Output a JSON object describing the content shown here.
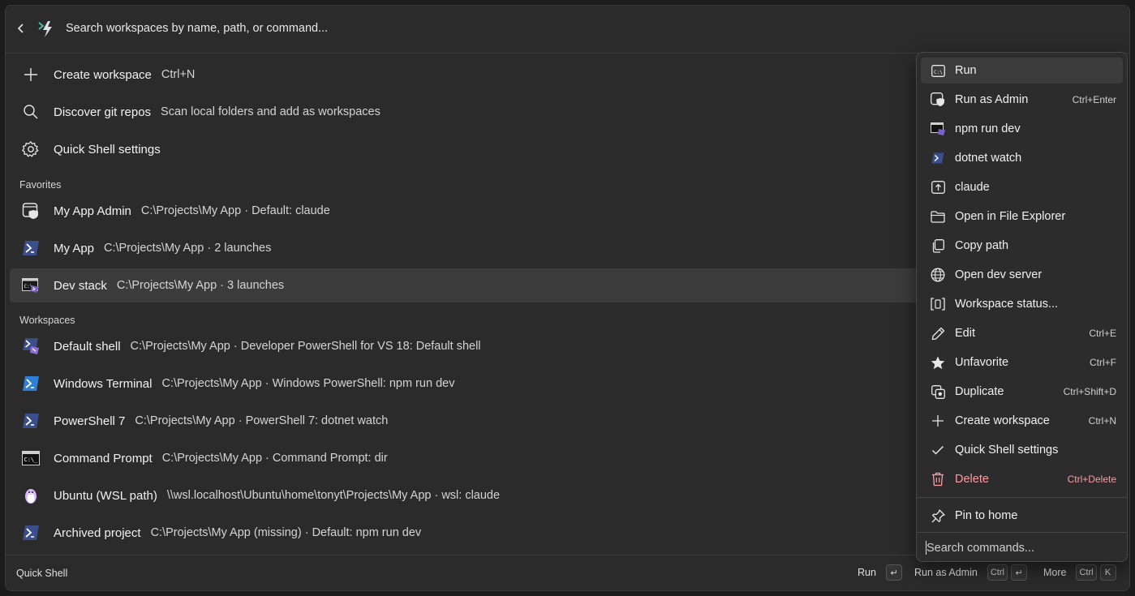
{
  "search": {
    "placeholder": "Search workspaces by name, path, or command..."
  },
  "actions": [
    {
      "icon": "plus-icon",
      "title": "Create workspace",
      "subtitle": "Ctrl+N"
    },
    {
      "icon": "search-icon",
      "title": "Discover git repos",
      "subtitle": "Scan local folders and add as workspaces"
    },
    {
      "icon": "gear-icon",
      "title": "Quick Shell settings",
      "subtitle": ""
    }
  ],
  "favorites": {
    "heading": "Favorites",
    "items": [
      {
        "icon": "shield-terminal-icon",
        "title": "My App Admin",
        "subtitle": "C:\\Projects\\My App · Default: claude"
      },
      {
        "icon": "powershell-icon",
        "title": "My App",
        "subtitle": "C:\\Projects\\My App · 2 launches"
      },
      {
        "icon": "cmd-stack-icon",
        "title": "Dev stack",
        "subtitle": "C:\\Projects\\My App · 3 launches",
        "selected": true
      }
    ]
  },
  "workspaces": {
    "heading": "Workspaces",
    "items": [
      {
        "icon": "dev-powershell-icon",
        "title": "Default shell",
        "subtitle": "C:\\Projects\\My App · Developer PowerShell for VS 18: Default shell"
      },
      {
        "icon": "windows-terminal-icon",
        "title": "Windows Terminal",
        "subtitle": "C:\\Projects\\My App · Windows PowerShell: npm run dev"
      },
      {
        "icon": "powershell-icon",
        "title": "PowerShell 7",
        "subtitle": "C:\\Projects\\My App · PowerShell 7: dotnet watch"
      },
      {
        "icon": "command-prompt-icon",
        "title": "Command Prompt",
        "subtitle": "C:\\Projects\\My App · Command Prompt: dir"
      },
      {
        "icon": "linux-penguin-icon",
        "title": "Ubuntu (WSL path)",
        "subtitle": "\\\\wsl.localhost\\Ubuntu\\home\\tonyt\\Projects\\My App · wsl: claude"
      },
      {
        "icon": "powershell-icon",
        "title": "Archived project",
        "subtitle": "C:\\Projects\\My App (missing) · Default: npm run dev"
      }
    ]
  },
  "status_bar": {
    "app_name": "Quick Shell",
    "hints": [
      {
        "label": "Run",
        "keys": [
          "↵"
        ]
      },
      {
        "label": "Run as Admin",
        "keys": [
          "Ctrl",
          "↵"
        ]
      },
      {
        "label": "More",
        "keys": [
          "Ctrl",
          "K"
        ]
      }
    ]
  },
  "context_menu": {
    "items": [
      {
        "icon": "run-terminal-icon",
        "label": "Run",
        "shortcut": "",
        "active": true
      },
      {
        "icon": "shield-icon",
        "label": "Run as Admin",
        "shortcut": "Ctrl+Enter"
      },
      {
        "icon": "cmd-stack-icon",
        "label": "npm run dev",
        "shortcut": ""
      },
      {
        "icon": "powershell-icon",
        "label": "dotnet watch",
        "shortcut": ""
      },
      {
        "icon": "upload-window-icon",
        "label": "claude",
        "shortcut": ""
      },
      {
        "icon": "folder-icon",
        "label": "Open in File Explorer",
        "shortcut": ""
      },
      {
        "icon": "copy-icon",
        "label": "Copy path",
        "shortcut": ""
      },
      {
        "icon": "globe-icon",
        "label": "Open dev server",
        "shortcut": ""
      },
      {
        "icon": "status-frame-icon",
        "label": "Workspace status...",
        "shortcut": ""
      },
      {
        "icon": "pencil-icon",
        "label": "Edit",
        "shortcut": "Ctrl+E"
      },
      {
        "icon": "star-icon",
        "label": "Unfavorite",
        "shortcut": "Ctrl+F"
      },
      {
        "icon": "duplicate-icon",
        "label": "Duplicate",
        "shortcut": "Ctrl+Shift+D"
      },
      {
        "icon": "plus-icon",
        "label": "Create workspace",
        "shortcut": "Ctrl+N"
      },
      {
        "icon": "checkmark-icon",
        "label": "Quick Shell settings",
        "shortcut": ""
      },
      {
        "icon": "trash-icon",
        "label": "Delete",
        "shortcut": "Ctrl+Delete",
        "danger": true
      },
      {
        "icon": "pin-icon",
        "label": "Pin to home",
        "shortcut": ""
      }
    ],
    "search_placeholder": "Search commands..."
  },
  "colors": {
    "danger": "#ff99a4",
    "selected_row": "#3c3c3c",
    "accent": "#3b8eea"
  }
}
